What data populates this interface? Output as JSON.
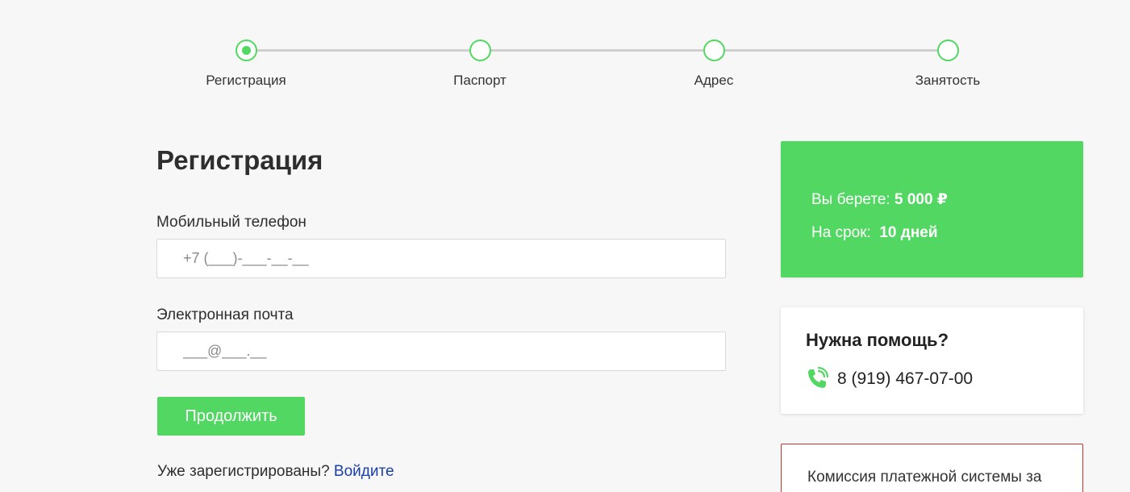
{
  "stepper": {
    "steps": [
      {
        "label": "Регистрация",
        "active": true
      },
      {
        "label": "Паспорт",
        "active": false
      },
      {
        "label": "Адрес",
        "active": false
      },
      {
        "label": "Занятость",
        "active": false
      }
    ]
  },
  "form": {
    "title": "Регистрация",
    "phone_label": "Мобильный телефон",
    "phone_placeholder": "+7 (___)-___-__-__",
    "email_label": "Электронная почта",
    "email_placeholder": "___@___.__",
    "continue_label": "Продолжить",
    "already_text": "Уже зарегистрированы?",
    "login_link": "Войдите"
  },
  "loan": {
    "amount_label": "Вы берете:",
    "amount_value": "5 000 ₽",
    "term_label": "На срок:",
    "term_value": "10 дней"
  },
  "help": {
    "title": "Нужна помощь?",
    "phone": "8 (919) 467-07-00",
    "icon": "phone-icon"
  },
  "fee": {
    "text": "Комиссия платежной системы за"
  },
  "colors": {
    "accent": "#52d862",
    "link": "#1a3fa6",
    "fee_border": "#d0312d"
  }
}
